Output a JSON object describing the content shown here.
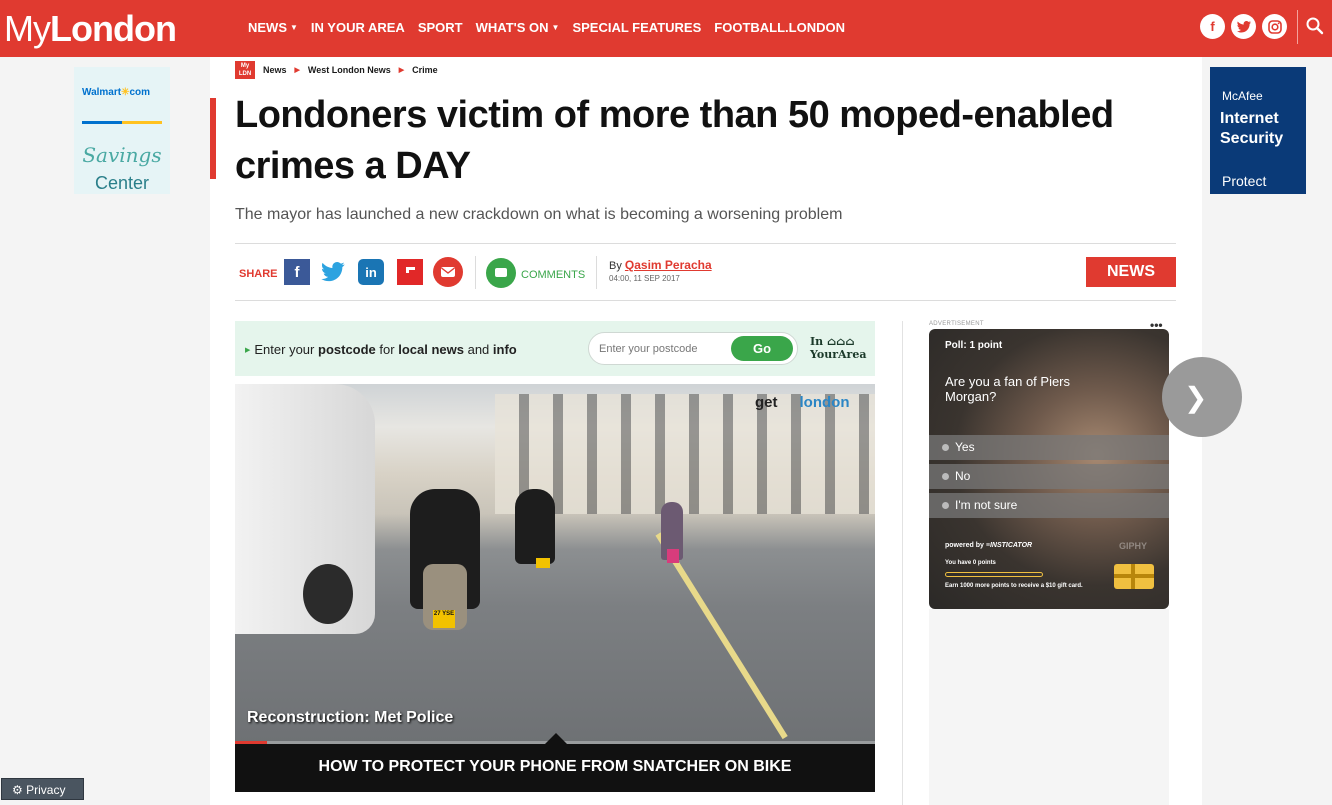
{
  "header": {
    "logo_prefix": "My",
    "logo_suffix": "London",
    "nav": [
      {
        "label": "NEWS",
        "dropdown": true
      },
      {
        "label": "IN YOUR AREA",
        "dropdown": false
      },
      {
        "label": "SPORT",
        "dropdown": false
      },
      {
        "label": "WHAT'S ON",
        "dropdown": true
      },
      {
        "label": "SPECIAL FEATURES",
        "dropdown": false
      },
      {
        "label": "FOOTBALL.LONDON",
        "dropdown": false
      }
    ],
    "social": [
      "facebook-icon",
      "twitter-icon",
      "instagram-icon"
    ],
    "brand_color": "#e03a30"
  },
  "ads": {
    "left": {
      "brand": "Walmart",
      "brand_suffix": "com",
      "line1": "Savings",
      "line2": "Center"
    },
    "right": {
      "brand": "McAfee",
      "product": "Internet Security",
      "cta": "Protect"
    }
  },
  "breadcrumb": {
    "logo_top": "My",
    "logo_bottom": "LDN",
    "items": [
      "News",
      "West London News",
      "Crime"
    ]
  },
  "article": {
    "headline": "Londoners victim of more than 50 moped-enabled crimes a DAY",
    "standfirst": "The mayor has launched a new crackdown on what is becoming a worsening problem",
    "share_label": "SHARE",
    "share_icons": [
      "facebook-icon",
      "twitter-icon",
      "linkedin-icon",
      "flipboard-icon",
      "email-icon"
    ],
    "comments_label": "COMMENTS",
    "by_label": "By",
    "author": "Qasim Peracha",
    "date": "04:00, 11 SEP 2017",
    "section_badge": "NEWS"
  },
  "postcode": {
    "prefix": "Enter your",
    "postcode": "postcode",
    "for": "for",
    "local_news": "local news",
    "and": "and",
    "info": "info",
    "placeholder": "Enter your postcode",
    "button": "Go",
    "brand_line1": "In",
    "brand_line2": "YourArea"
  },
  "video": {
    "watermark_left": "get",
    "watermark_right": "london",
    "plate_text": "27 YSE",
    "caption": "Reconstruction: Met Police",
    "title": "HOW TO PROTECT YOUR PHONE FROM SNATCHER ON BIKE",
    "progress": 0.05
  },
  "poll": {
    "ad_label": "ADVERTISEMENT",
    "menu": "•••",
    "points": "Poll: 1 point",
    "question": "Are you a fan of Piers Morgan?",
    "options": [
      "Yes",
      "No",
      "I'm not sure"
    ],
    "powered_by": "powered by",
    "provider": "≡INSTICATOR",
    "you_have": "You have 0 points",
    "earn": "Earn 1000 more points to receive a $10 gift card.",
    "giphy": "GIPHY",
    "progress": 0
  },
  "privacy": {
    "label": "Privacy"
  }
}
